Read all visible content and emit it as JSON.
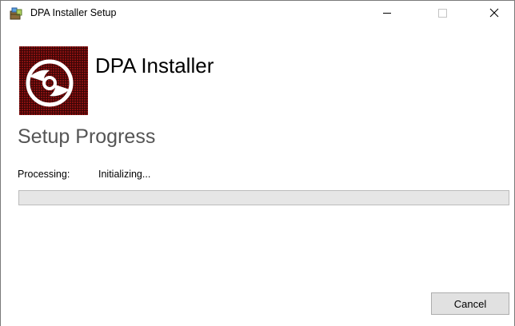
{
  "window": {
    "title": "DPA Installer Setup",
    "caption_buttons": [
      "minimize-icon",
      "maximize-icon",
      "close-icon"
    ]
  },
  "header": {
    "logo_icon": "disc-icon",
    "product_title": "DPA Installer"
  },
  "main": {
    "section_title": "Setup Progress",
    "processing_label": "Processing:",
    "processing_status": "Initializing...",
    "progress_percent": 0
  },
  "footer": {
    "cancel_label": "Cancel"
  },
  "colors": {
    "logo_background": "#5a0a0a",
    "progress_track": "#e6e6e6",
    "button_face": "#e1e1e1"
  }
}
